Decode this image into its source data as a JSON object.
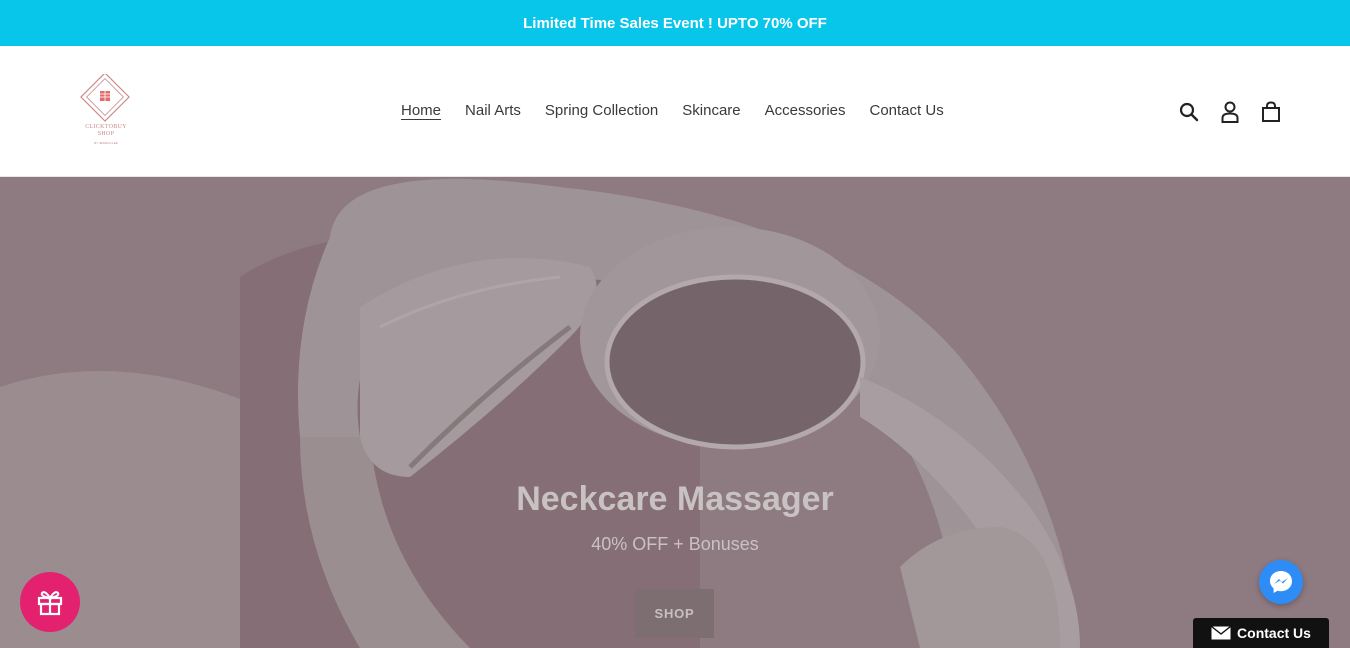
{
  "announcement": {
    "text": "Limited Time Sales Event ! UPTO 70% OFF"
  },
  "logo": {
    "line1": "CLICKTOBUY",
    "line2": "SHOP",
    "tagline": "BY JESSICA LEE",
    "color": "#c98a8a"
  },
  "nav": {
    "items": [
      {
        "label": "Home",
        "active": true
      },
      {
        "label": "Nail Arts"
      },
      {
        "label": "Spring Collection"
      },
      {
        "label": "Skincare"
      },
      {
        "label": "Accessories"
      },
      {
        "label": "Contact Us"
      }
    ]
  },
  "header_icons": [
    "search-icon",
    "account-icon",
    "cart-icon"
  ],
  "hero": {
    "title": "Neckcare Massager",
    "subtitle": "40% OFF + Bonuses",
    "button_label": "SHOP"
  },
  "widgets": {
    "gift_icon": "gift-icon",
    "messenger_icon": "messenger-icon",
    "contact_label": "Contact Us"
  },
  "colors": {
    "announcement_bg": "#08c5ea",
    "gift_bg": "#e4216f",
    "messenger_bg": "#2d8cf5",
    "contact_bg": "#111111"
  }
}
